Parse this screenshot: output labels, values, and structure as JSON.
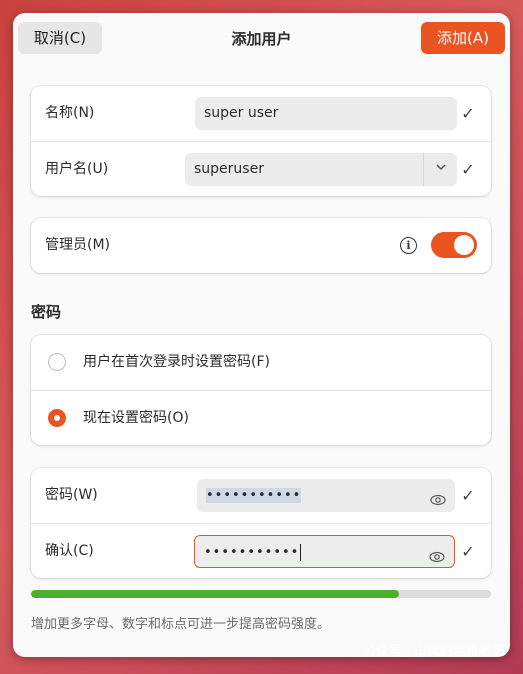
{
  "header": {
    "cancel_label": "取消(C)",
    "title": "添加用户",
    "add_label": "添加(A)"
  },
  "account": {
    "name_label": "名称(N)",
    "name_value": "super user",
    "username_label": "用户名(U)",
    "username_value": "superuser",
    "username_dropdown_icon": "chevron-down-icon",
    "check_icon": "checkmark-icon"
  },
  "admin": {
    "label": "管理员(M)",
    "enabled": true
  },
  "password_section": {
    "title": "密码",
    "options": [
      {
        "label": "用户在首次登录时设置密码(F)",
        "selected": false
      },
      {
        "label": "现在设置密码(O)",
        "selected": true
      }
    ]
  },
  "password_fields": {
    "password_label": "密码(W)",
    "password_value": "•••••••••••",
    "confirm_label": "确认(C)",
    "confirm_value": "•••••••••••"
  },
  "strength": {
    "fraction": 0.8
  },
  "hint": "增加更多字母、数字和标点可进一步提高密码强度。",
  "watermark": "公众号 · 山岚的运维笔记",
  "colors": {
    "accent": "#e95420",
    "strength": "#4caf2f"
  }
}
